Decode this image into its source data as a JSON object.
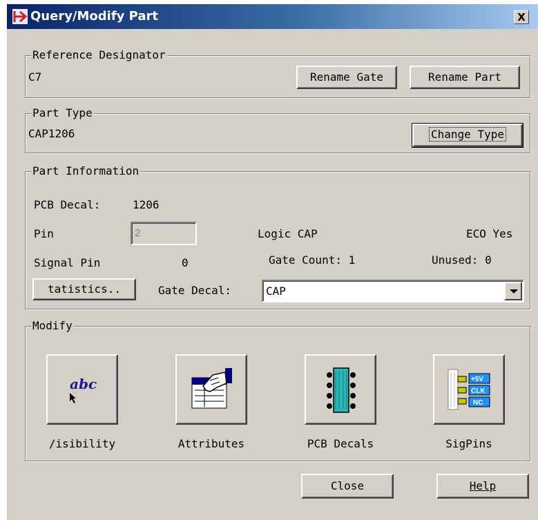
{
  "window": {
    "title": "Query/Modify Part",
    "close_label": "X"
  },
  "reference_designator": {
    "label": "Reference Designator",
    "value": "C7",
    "rename_gate_label": "Rename Gate",
    "rename_part_label": "Rename Part"
  },
  "part_type": {
    "label": "Part Type",
    "value": "CAP1206",
    "change_type_label": "Change Type"
  },
  "part_information": {
    "label": "Part Information",
    "pcb_decal_label": "PCB Decal:",
    "pcb_decal_value": "1206",
    "pin_label": "Pin",
    "pin_value": "2",
    "logic_text": "Logic CAP",
    "eco_text": "ECO Yes",
    "signal_pin_label": "Signal Pin",
    "signal_pin_value": "0",
    "gate_count_text": "Gate Count: 1",
    "unused_text": "Unused: 0",
    "statistics_label": "tatistics..",
    "gate_decal_label": "Gate Decal:",
    "gate_decal_value": "CAP"
  },
  "modify": {
    "label": "Modify",
    "items": [
      {
        "label": "/isibility",
        "icon": "visibility-icon",
        "icon_text": "abc"
      },
      {
        "label": "Attributes",
        "icon": "attributes-icon"
      },
      {
        "label": "PCB Decals",
        "icon": "pcb-decals-icon"
      },
      {
        "label": "SigPins",
        "icon": "sigpins-icon",
        "icon_texts": [
          "+5V",
          "CLK",
          "NC"
        ]
      }
    ]
  },
  "footer": {
    "close_label": "Close",
    "help_label": "Help"
  },
  "colors": {
    "title_start": "#0a246a",
    "title_end": "#a6caf0",
    "face": "#d4d0c8",
    "pcb_chip": "#29b6b6"
  }
}
